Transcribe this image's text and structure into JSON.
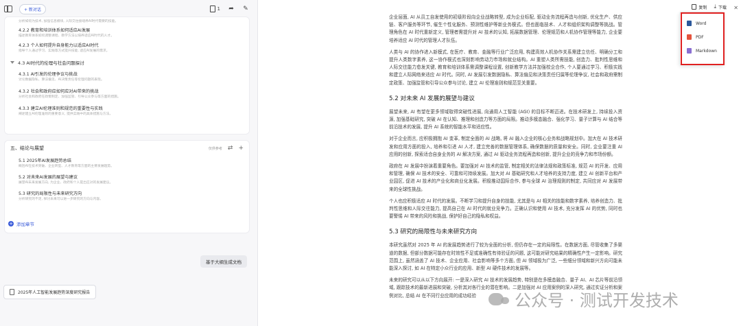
{
  "topbar": {
    "new_label": "+ 新对话",
    "doc_count": "1"
  },
  "outline_card1": {
    "partial_desc": "分析如何为技术, 加强信息模块, 人际交往接培养AI时代需要的技能。",
    "items": [
      {
        "title": "4.2.2 教育和培训体系如何适应AI发展",
        "desc": "描述教育体系如何调整课程、教学方法以培养适应AI时代的人才。"
      },
      {
        "title": "4.2.3 个人如何提升自身能力以适应AI时代",
        "desc": "指导个人通过学习、实践等方式提升技能, 适应AI发展的需求。"
      }
    ],
    "chapter": "4.3 AI时代的伦理与社会问题探讨",
    "sub_items": [
      {
        "title": "4.3.1 AI引发的伦理争议与挑战",
        "desc": "讨论数据隐私、算法偏见、AI决策责任等伦理问题的表现。"
      },
      {
        "title": "4.3.2 社会和政府应如何应对AI带来的挑战",
        "desc": "分析社会和政府在政策制定、加强监管、引导公众参与等方面的措施。"
      },
      {
        "title": "4.3.3 建立AI伦理准则和规范的重要性与实践",
        "desc": "阐述建立AI伦理准则的重要意义, 提供实践中的具体措施与方法。"
      }
    ]
  },
  "outline_card2": {
    "section_title": "五、结论与展望",
    "tools_label": "仅供参考",
    "items": [
      {
        "title": "5.1 2025年AI发展趋势总结",
        "desc": "概括AI在技术突破、企业转型、人才教育等方面的主要发展趋势。"
      },
      {
        "title": "5.2 对未来AI发展的展望与建议",
        "desc": "展望AI未来发展方向, 为企业、政府和个人提出应对的发展建议。"
      },
      {
        "title": "5.3 研究的局限性与未来研究方向",
        "desc": "分析研究的不足, 探讨未来可以进一步研究的方向与内容。"
      }
    ]
  },
  "add_chapter_label": "添加章节",
  "generate_button": "基于大纲生成文档",
  "file_chip": "2025年人工智能发展趋势深度研究报告",
  "toolbar": {
    "copy": "复制",
    "download": "下载"
  },
  "download_menu": [
    "Word",
    "PDF",
    "Markdown"
  ],
  "doc": {
    "p1": "企业层面, AI 从员工自发使用的初级阶段向企业战略转型, 成为企业标配, 驱动业务流程再造与创新, 优化生产、供应链、客户服务等环节, 催生个性化服务、预测性维护等新业务模式。但也面临技术、人才和组织架构调整等挑战。管理角色在 AI 时代重新定义, 管理者需提升对 AI 技术的认知, 拓展数据管理、伦理规范和人机协作管理等能力, 企业要培养适应 AI 时代的管理人才队伍。",
    "p2": "人类与 AI 的协作进入新模式, 在医疗、教育、金融等行业广泛应用, 构建高效人机协作关系需建立信任、明确分工和提升人类数字素养, 这一协作模式也深刻影响劳动力市场和就业结构。AI 重塑人类所需技能, 创造力、批判性思维和人际交往能力愈发关键, 教育和培训体系需调整课程设置, 创新教学方法并加强校企合作, 个人要通过学习、积极实践和建立人际网络来适应 AI 时代。同时, AI 发展引发数据隐私、算法偏见和决策责任归属等伦理争议, 社会和政府需制定政策、加强监管和引导公众参与讨论, 建立 AI 伦理准则和规范至关重要。",
    "h1": "5.2 对未来 AI 发展的展望与建议",
    "p3": "展望未来, AI 有望在更多领域取得突破性进展, 向通用人工智能 (AGI) 的目标不断迈进。在技术研发上, 持续投入资源, 加强基础研究, 突破 AI 在认知、推理和创造力等方面的局限。推动多模态融合、强化学习、量子计算与 AI 结合等前沿技术的发展, 提升 AI 系统的智能水平和适应性。",
    "p4": "对于企业而言, 应积极拥抱 AI 变革, 制定全面的 AI 战略, 将 AI 融入企业的核心业务和战略规划中。加大在 AI 技术研发和应用方面的投入, 培养和引进 AI 人才, 建立完善的数据管理体系, 确保数据的质量和安全。同时, 企业要注重 AI 应用的创新, 探索适合自身业务的 AI 解决方案, 通过 AI 驱动业务流程再造和创新, 提升企业的竞争力和市场份额。",
    "p5": "政府在 AI 发展中扮演着重要角色。要加强对 AI 技术的监管, 制定相关的法律法规和政策标准, 规范 AI 的开发、应用和管理, 确保 AI 技术的安全、可靠和可持续发展。加大对 AI 基础研究和人才培养的支持力度, 建立 AI 创新平台和产业园区, 促进 AI 技术的产业化和商业化发展。积极推动国际合作, 参与全球 AI 治理规则的制定, 共同应对 AI 发展带来的全球性挑战。",
    "p6": "个人也应积极适应 AI 时代的发展。不断学习和提升自身的技能, 尤其是与 AI 相关的技能和数字素养, 培养创造力、批判性思维和人际交往能力, 提高自己在 AI 时代的就业竞争力。正确认识和使用 AI 技术, 充分发挥 AI 的优势, 同时也要警惕 AI 带来的风险和挑战, 保护好自己的隐私和权益。",
    "h2": "5.3 研究的局限性与未来研究方向",
    "p7": "本研究虽然对 2025 年 AI 的发展趋势进行了较为全面的分析, 但仍存在一定的局限性。在数据方面, 尽管收集了多渠道的数据, 但部分数据可能存在时效性不足或准确性有待验证的问题, 这可能对研究结果的精确性产生一定影响。研究范围上, 虽然涵盖了 AI 技术、企业应用、社会影响等多个方面, 但 AI 领域极为广泛, 一些细分领域和新兴方向可能未能深入探讨, 如 AI 在特定小众行业的应用、新型 AI 硬件技术的发展等。",
    "p8": "未来的研究可以从以下方向展开: 一是深入研究 AI 技术的发展趋势, 特别是在多模态融合、量子 AI、AI 芯片等前沿领域, 跟踪技术的最新进展和突破, 分析其对各行业的潜在影响。二是加强对 AI 应用案例的深入研究, 通过实证分析和案例对比, 总结 AI 在不同行业应用的成功经验"
  },
  "watermark": "公众号 · 测试开发技术"
}
